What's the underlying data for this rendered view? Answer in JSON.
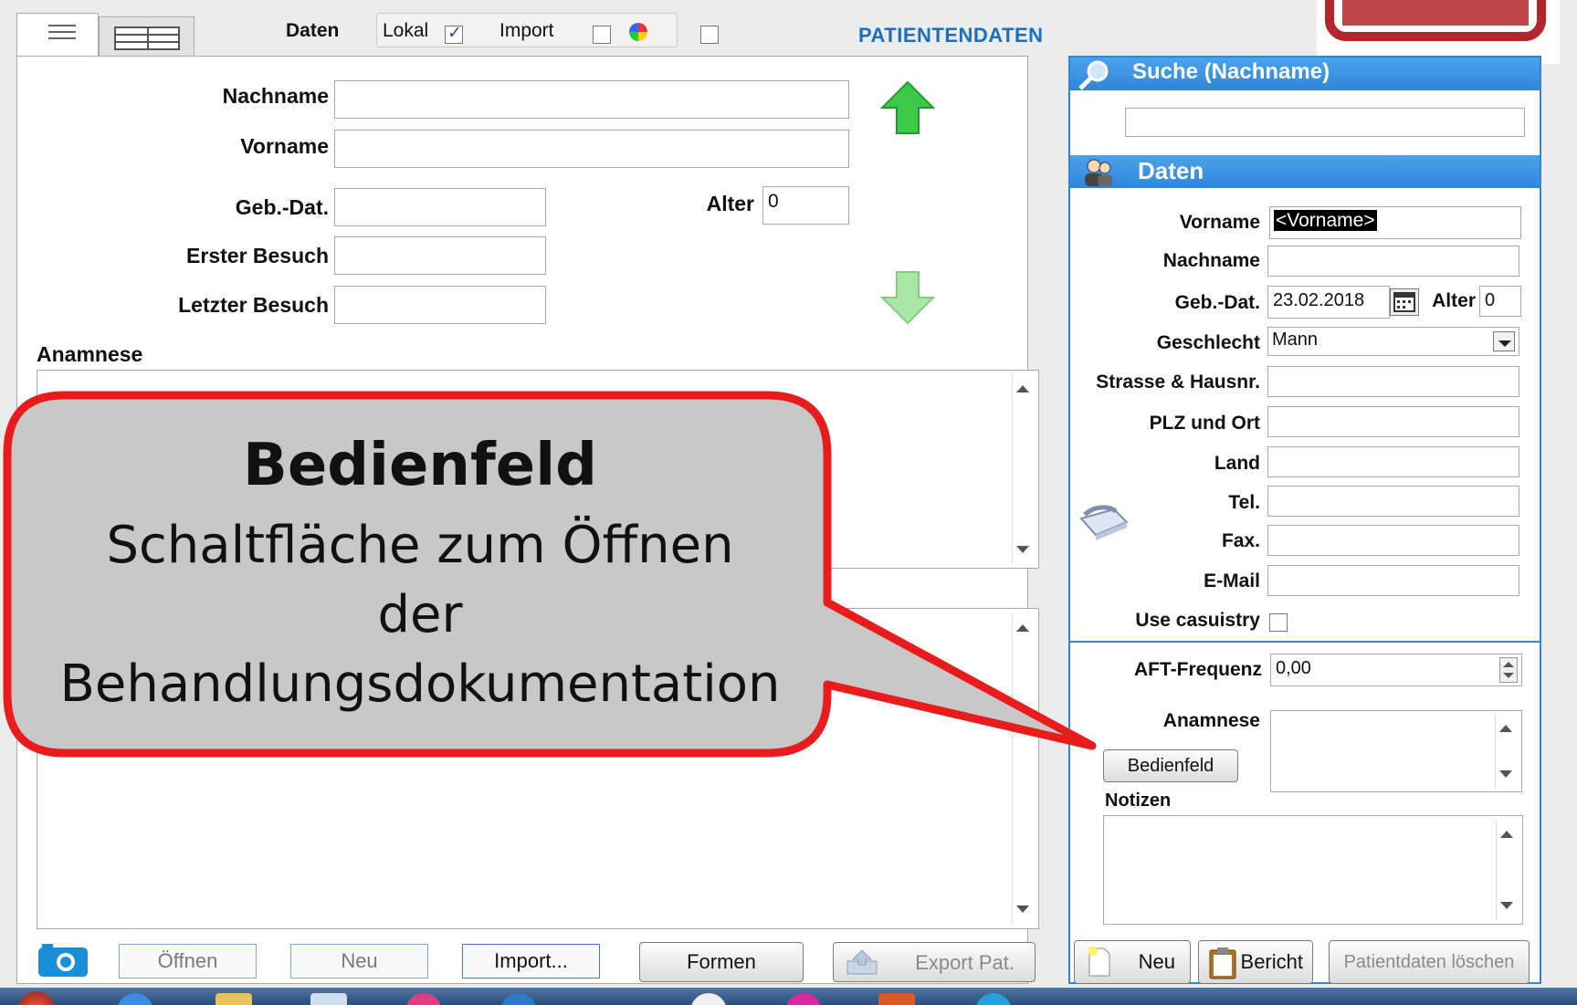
{
  "tabs": {
    "data_label": "Daten",
    "local_label": "Lokal",
    "import_label": "Import",
    "local_checked": true,
    "import_checked": false
  },
  "header_title": "PATIENTENDATEN",
  "left": {
    "nachname_label": "Nachname",
    "vorname_label": "Vorname",
    "geb_label": "Geb.-Dat.",
    "alter_label": "Alter",
    "alter_value": "0",
    "erster_label": "Erster Besuch",
    "letzter_label": "Letzter Besuch",
    "anamnese_label": "Anamnese"
  },
  "callout": {
    "title": "Bedienfeld",
    "line1": "Schaltfläche zum Öffnen",
    "line2": "der",
    "line3": "Behandlungsdokumentation",
    "color": "#e81c1c"
  },
  "bottom_left": {
    "open": "Öffnen",
    "new": "Neu",
    "import": "Import...",
    "forms": "Formen",
    "export": "Export Pat."
  },
  "search": {
    "title": "Suche (Nachname)"
  },
  "daten": {
    "title": "Daten",
    "vorname_label": "Vorname",
    "vorname_value": "<Vorname>",
    "nachname_label": "Nachname",
    "geb_label": "Geb.-Dat.",
    "geb_value": "23.02.2018",
    "alter_label": "Alter",
    "alter_value": "0",
    "geschlecht_label": "Geschlecht",
    "geschlecht_value": "Mann",
    "strasse_label": "Strasse & Hausnr.",
    "plz_label": "PLZ und Ort",
    "land_label": "Land",
    "tel_label": "Tel.",
    "fax_label": "Fax.",
    "email_label": "E-Mail",
    "casuistry_label": "Use casuistry",
    "aft_label": "AFT-Frequenz",
    "aft_value": "0,00",
    "anamnese_label": "Anamnese",
    "bedienfeld_button": "Bedienfeld",
    "notizen_label": "Notizen"
  },
  "bottom_right": {
    "new": "Neu",
    "report": "Bericht",
    "delete": "Patientdaten löschen"
  },
  "colors": {
    "accent_blue": "#2f86d8",
    "title_blue": "#1a6fc1",
    "stamp_red": "#b3262b"
  }
}
